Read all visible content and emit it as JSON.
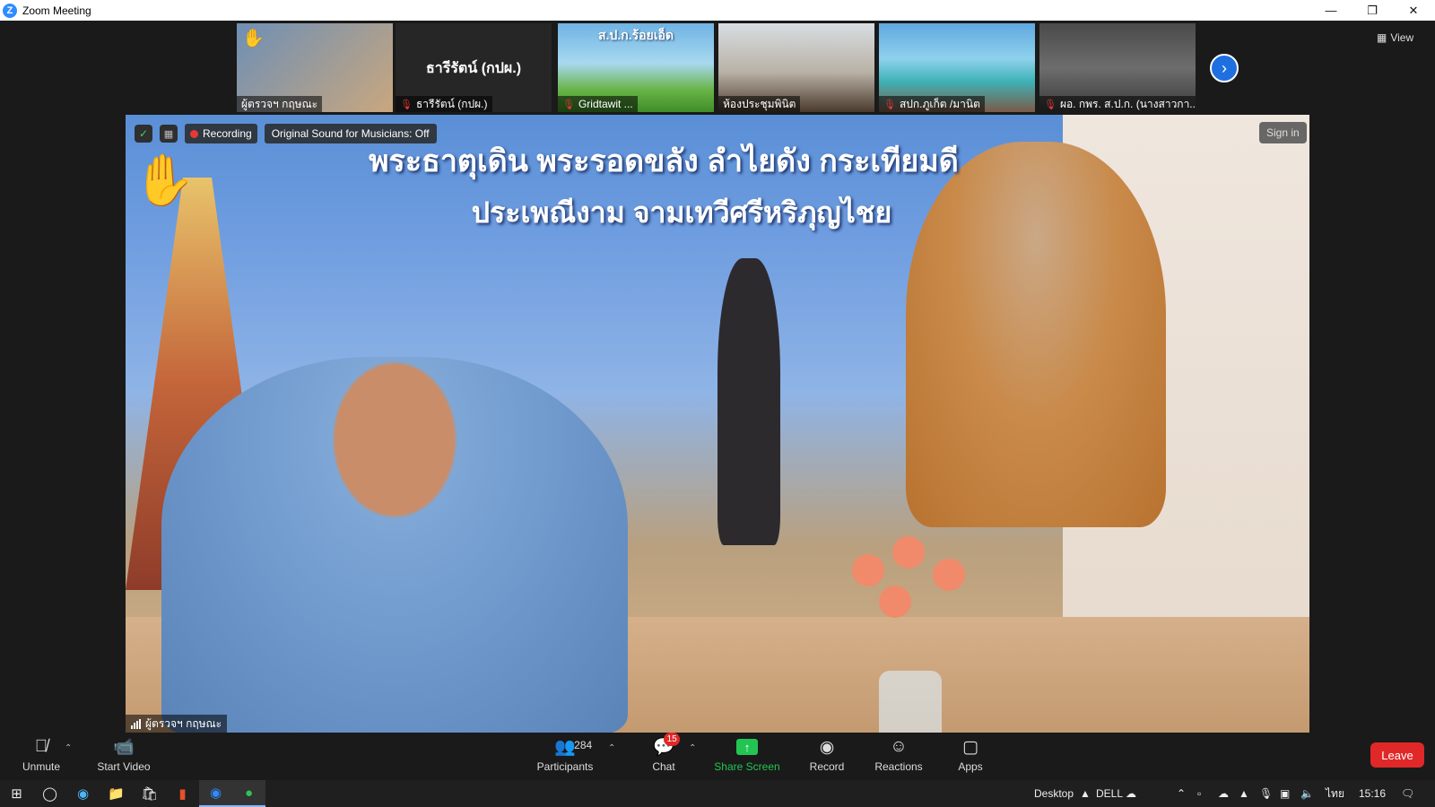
{
  "window": {
    "title": "Zoom Meeting",
    "app_icon": "Z"
  },
  "gallery": {
    "tiles": [
      {
        "name": "ผู้ตรวจฯ กฤษณะ",
        "mic_muted": false,
        "raised_hand": true
      },
      {
        "name": "ธารีรัตน์ (กปผ.)",
        "center_label": "ธารีรัตน์ (กปผ.)",
        "mic_muted": true
      },
      {
        "name": "Gridtawit ...",
        "mic_muted": true,
        "thumb_text": "ส.ป.ก.ร้อยเอ็ด"
      },
      {
        "name": "ห้องประชุมพินิต",
        "mic_muted": false
      },
      {
        "name": "สปก.ภูเก็ต /มานิต",
        "mic_muted": true
      },
      {
        "name": "ผอ. กพร. ส.ป.ก. (นางสาวกา...",
        "mic_muted": true
      }
    ],
    "next_icon": "chevron-right",
    "view_label": "View"
  },
  "main_video": {
    "banner_line1": "พระธาตุเดิน พระรอดขลัง ลำไยดัง กระเทียมดี",
    "banner_line2": "ประเพณีงาม จามเทวีศรีหริภุญไชย",
    "recording_label": "Recording",
    "sound_label": "Original Sound for Musicians: Off",
    "signin_label": "Sign in",
    "speaker_name": "ผู้ตรวจฯ กฤษณะ"
  },
  "toolbar": {
    "unmute": "Unmute",
    "start_video": "Start Video",
    "participants": "Participants",
    "participants_count": "284",
    "chat": "Chat",
    "chat_badge": "15",
    "share_screen": "Share Screen",
    "record": "Record",
    "reactions": "Reactions",
    "apps": "Apps",
    "leave": "Leave"
  },
  "taskbar": {
    "desktop_label": "Desktop",
    "dell_label": "DELL",
    "lang": "ไทย",
    "time": "15:16"
  },
  "colors": {
    "accent": "#2d8cff",
    "share": "#23c552",
    "leave": "#e02828",
    "raise_hand": "#f5b800"
  }
}
